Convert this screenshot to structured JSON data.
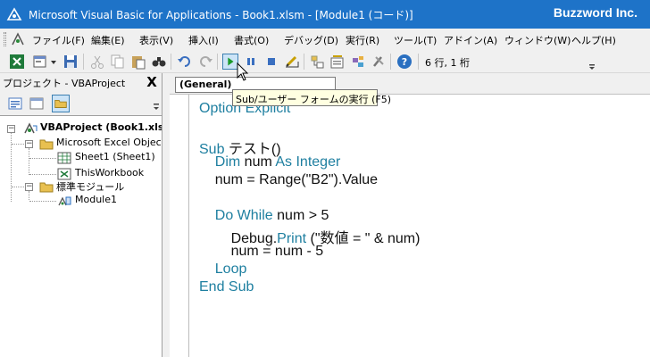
{
  "window": {
    "title": "Microsoft Visual Basic for Applications - Book1.xlsm - [Module1 (コード)]",
    "brand": "Buzzword Inc."
  },
  "menu": [
    "ファイル(F)",
    "編集(E)",
    "表示(V)",
    "挿入(I)",
    "書式(O)",
    "デバッグ(D)",
    "実行(R)",
    "ツール(T)",
    "アドイン(A)",
    "ウィンドウ(W)",
    "ヘルプ(H)"
  ],
  "toolbar": {
    "position": "6 行, 1 桁",
    "tooltip": "Sub/ユーザー フォームの実行 (F5)"
  },
  "project": {
    "title": "プロジェクト - VBAProject",
    "close": "X",
    "root": "VBAProject (Book1.xls",
    "excel_objects": "Microsoft Excel Object",
    "sheet1": "Sheet1 (Sheet1)",
    "this_workbook": "ThisWorkbook",
    "modules_folder": "標準モジュール",
    "module1": "Module1"
  },
  "code": {
    "object_combo": "(General)",
    "lines": [
      [
        {
          "t": "Option Explicit",
          "k": 1
        }
      ],
      [],
      [
        {
          "t": "Sub ",
          "k": 1
        },
        {
          "t": "テスト()",
          "k": 0
        }
      ],
      [
        {
          "t": "    ",
          "k": 0
        },
        {
          "t": "Dim ",
          "k": 1
        },
        {
          "t": "num ",
          "k": 0
        },
        {
          "t": "As Integer",
          "k": 1
        }
      ],
      [
        {
          "t": "    num = Range(\"B2\").Value",
          "k": 0
        }
      ],
      [],
      [
        {
          "t": "    ",
          "k": 0
        },
        {
          "t": "Do While ",
          "k": 1
        },
        {
          "t": "num > 5",
          "k": 0
        }
      ],
      [
        {
          "t": "        ",
          "k": 0
        },
        {
          "t": "Debug",
          "k": 0
        },
        {
          "t": ".",
          "k": 0
        },
        {
          "t": "Print ",
          "k": 1
        },
        {
          "t": "(\"数値 = \" & num)",
          "k": 0
        }
      ],
      [
        {
          "t": "        num = num - 5",
          "k": 0
        }
      ],
      [
        {
          "t": "    ",
          "k": 0
        },
        {
          "t": "Loop",
          "k": 1
        }
      ],
      [
        {
          "t": "End Sub",
          "k": 1
        }
      ]
    ]
  },
  "colors": {
    "titlebar": "#1e73c8",
    "keyword": "#1e7fa0",
    "tooltip_bg": "#ffffe1"
  }
}
